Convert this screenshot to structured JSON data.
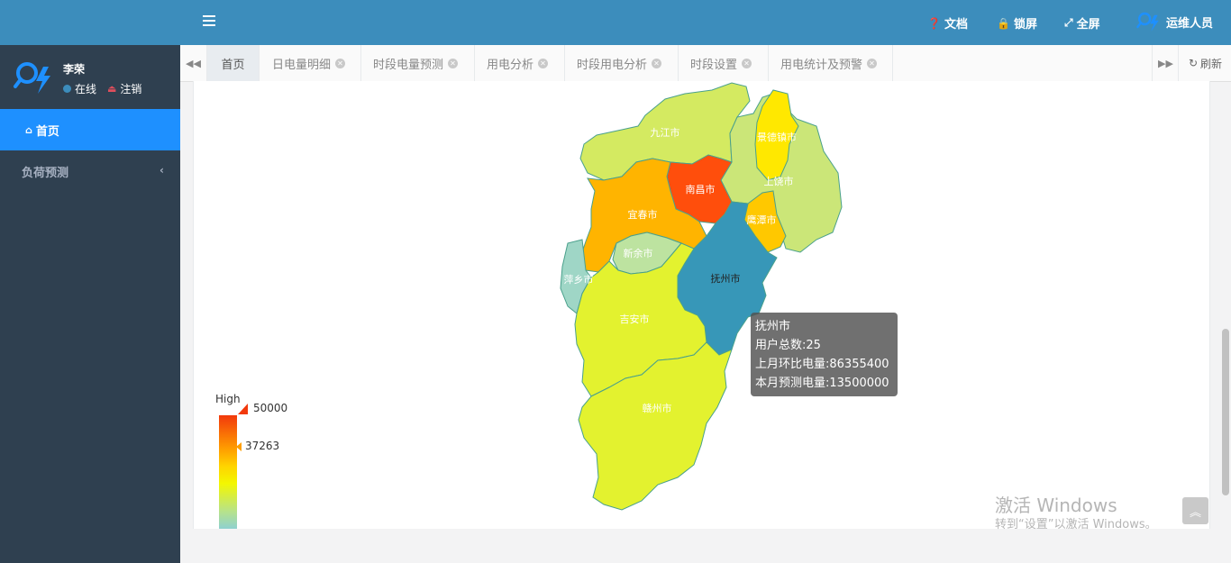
{
  "sidebar": {
    "user_name": "李荣",
    "status_online": "在线",
    "logout": "注销",
    "nav_home": "首页",
    "nav_forecast": "负荷预测"
  },
  "header": {
    "docs": "文档",
    "lock": "锁屏",
    "fullscreen": "全屏",
    "role": "运维人员"
  },
  "tabs": [
    {
      "label": "首页",
      "active": true
    },
    {
      "label": "日电量明细"
    },
    {
      "label": "时段电量预测"
    },
    {
      "label": "用电分析"
    },
    {
      "label": "时段用电分析"
    },
    {
      "label": "时段设置"
    },
    {
      "label": "用电统计及预警"
    }
  ],
  "refresh": "刷新",
  "map": {
    "cities": [
      "九江市",
      "景德镇市",
      "上饶市",
      "南昌市",
      "宜春市",
      "鹰潭市",
      "新余市",
      "抚州市",
      "萍乡市",
      "吉安市",
      "赣州市"
    ]
  },
  "tooltip": {
    "city": "抚州市",
    "users": "用户总数:25",
    "last_month": "上月环比电量:86355400",
    "forecast": "本月预测电量:13500000"
  },
  "legend": {
    "high": "High",
    "max": "50000",
    "mid": "37263"
  },
  "watermark": {
    "line1": "激活 Windows",
    "line2": "转到“设置”以激活 Windows。"
  },
  "colors": {
    "header": "#3c8dbc",
    "sidebar": "#2f4050",
    "active_nav": "#1e90ff"
  }
}
